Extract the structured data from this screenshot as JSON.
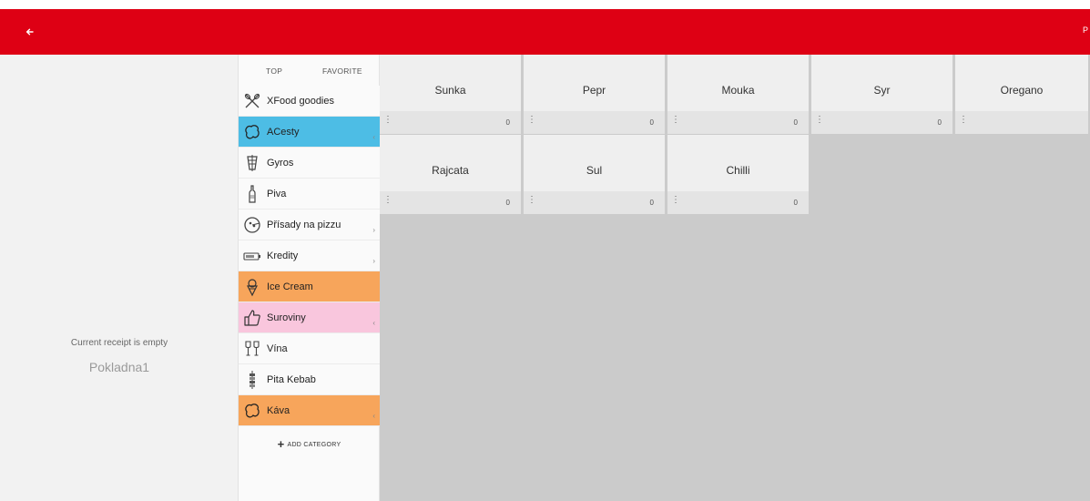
{
  "topbar": {
    "back_icon": "arrow-left-icon",
    "right_text": "P",
    "color": "#de0014"
  },
  "receipt": {
    "empty_text": "Current receipt is empty",
    "register_name": "Pokladna1"
  },
  "category_tabs": {
    "top": "TOP",
    "favorite": "FAVORITE"
  },
  "categories": [
    {
      "label": "XFood goodies",
      "icon": "cutlery-icon",
      "color": "",
      "arrow": ""
    },
    {
      "label": "ACesty",
      "icon": "food-blob-icon",
      "color": "blue",
      "arrow": "‹"
    },
    {
      "label": "Gyros",
      "icon": "gyros-icon",
      "color": "",
      "arrow": ""
    },
    {
      "label": "Piva",
      "icon": "bottle-icon",
      "color": "",
      "arrow": ""
    },
    {
      "label": "Přísady na pizzu",
      "icon": "pizza-icon",
      "color": "",
      "arrow": "›"
    },
    {
      "label": "Kredity",
      "icon": "battery-icon",
      "color": "",
      "arrow": "›"
    },
    {
      "label": "Ice Cream",
      "icon": "ice-cream-icon",
      "color": "orange",
      "arrow": ""
    },
    {
      "label": "Suroviny",
      "icon": "thumbs-up-icon",
      "color": "pink",
      "arrow": "‹"
    },
    {
      "label": "Vína",
      "icon": "wine-glasses-icon",
      "color": "",
      "arrow": ""
    },
    {
      "label": "Pita Kebab",
      "icon": "kebab-icon",
      "color": "",
      "arrow": ""
    },
    {
      "label": "Káva",
      "icon": "food-blob-icon",
      "color": "orange",
      "arrow": "‹"
    }
  ],
  "add_category": {
    "label": "ADD CATEGORY"
  },
  "products": [
    {
      "name": "Sunka",
      "qty": "0"
    },
    {
      "name": "Pepr",
      "qty": "0"
    },
    {
      "name": "Mouka",
      "qty": "0"
    },
    {
      "name": "Syr",
      "qty": "0"
    },
    {
      "name": "Oregano",
      "qty": ""
    },
    {
      "name": "Rajcata",
      "qty": "0"
    },
    {
      "name": "Sul",
      "qty": "0"
    },
    {
      "name": "Chilli",
      "qty": "0"
    }
  ],
  "colors": {
    "blue": "#4dbde5",
    "orange": "#f7a55b",
    "pink": "#f9c6dd",
    "grid_bg": "#cbcbcb"
  }
}
